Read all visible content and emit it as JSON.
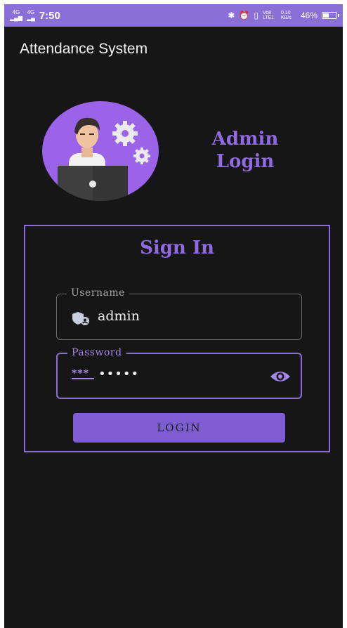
{
  "status_bar": {
    "time": "7:50",
    "network_left_1": "4G",
    "network_left_2": "4G",
    "volte": "Vo8 LTE1",
    "data_speed": "0.10 KB/s",
    "battery_percent": "46%",
    "battery_level": 0.46
  },
  "app_bar": {
    "title": "Attendance System"
  },
  "header": {
    "title": "Admin Login"
  },
  "signin": {
    "title": "Sign In",
    "username_label": "Username",
    "username_value": "admin",
    "password_label": "Password",
    "password_stars": "***",
    "password_value": "•••••",
    "login_label": "LOGIN"
  },
  "colors": {
    "accent": "#8a6fd6",
    "background": "#161616",
    "avatar_bg": "#9b63e8",
    "button": "#7e5dd2"
  },
  "icons": {
    "username": "user-shield-icon",
    "password": "password-icon",
    "visibility": "eye-icon",
    "avatar": "admin-avatar-icon"
  }
}
